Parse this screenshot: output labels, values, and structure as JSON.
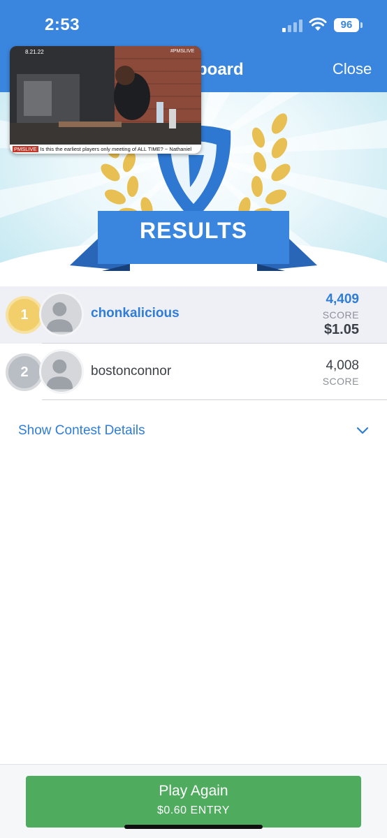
{
  "status_bar": {
    "time": "2:53",
    "battery": "96"
  },
  "header": {
    "title_visible": "board",
    "close_label": "Close"
  },
  "banner": {
    "label": "RESULTS"
  },
  "video": {
    "date": "8.21.22",
    "tag": "#PMSLIVE",
    "ticker_tag": "PMSLIVE",
    "ticker": "Is this the earliest players only meeting of ALL TIME? ~ Nathaniel"
  },
  "leaderboard": [
    {
      "rank": "1",
      "username": "chonkalicious",
      "score": "4,409",
      "score_label": "SCORE",
      "prize": "$1.05",
      "highlighted": true
    },
    {
      "rank": "2",
      "username": "bostonconnor",
      "score": "4,008",
      "score_label": "SCORE",
      "prize": ""
    }
  ],
  "details_label": "Show Contest Details",
  "play_button": {
    "label": "Play Again",
    "sub_label": "$0.60 ENTRY"
  },
  "colors": {
    "header_blue": "#3a86de",
    "accent_blue": "#2f7dd6",
    "gold": "#f2cf6a",
    "silver": "#b9bdc4",
    "play_green": "#4fac5e"
  }
}
